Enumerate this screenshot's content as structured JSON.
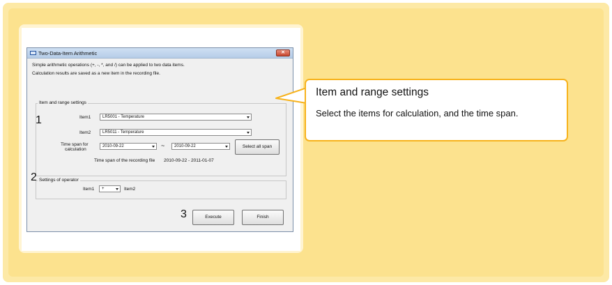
{
  "window": {
    "title": "Two-Data-Item Arithmetic",
    "close_label": "✕",
    "description_line1": "Simple arithmetic operations (+, -, *, and /) can be applied to two data items.",
    "description_line2": "Calculation results are saved as a new item in the recording file."
  },
  "section1": {
    "number": "1",
    "label": "Item and range settings",
    "item1_label": "Item1",
    "item1_value": "LR5001 - Temperature",
    "item2_label": "Item2",
    "item2_value": "LR5011 - Temperature",
    "timespan_label_line1": "Time span for",
    "timespan_label_line2": "calculation",
    "start_date": "2010-09-22",
    "tilde": "~",
    "end_date": "2010-09-22",
    "select_all_button": "Select all span",
    "recording_span_label": "Time span of the recording file",
    "recording_span_value": "2010-09-22 - 2011-01-07"
  },
  "section2": {
    "number": "2",
    "label": "Settings of operator",
    "item1_label": "Item1",
    "operator_value": "+",
    "item2_label": "Item2"
  },
  "section3": {
    "number": "3",
    "execute_button": "Execute",
    "finish_button": "Finish"
  },
  "callout": {
    "title": "Item and range settings",
    "body": "Select the items for calculation, and the time span."
  },
  "colors": {
    "background": "#fce28e",
    "callout_border": "#f7b21b"
  }
}
